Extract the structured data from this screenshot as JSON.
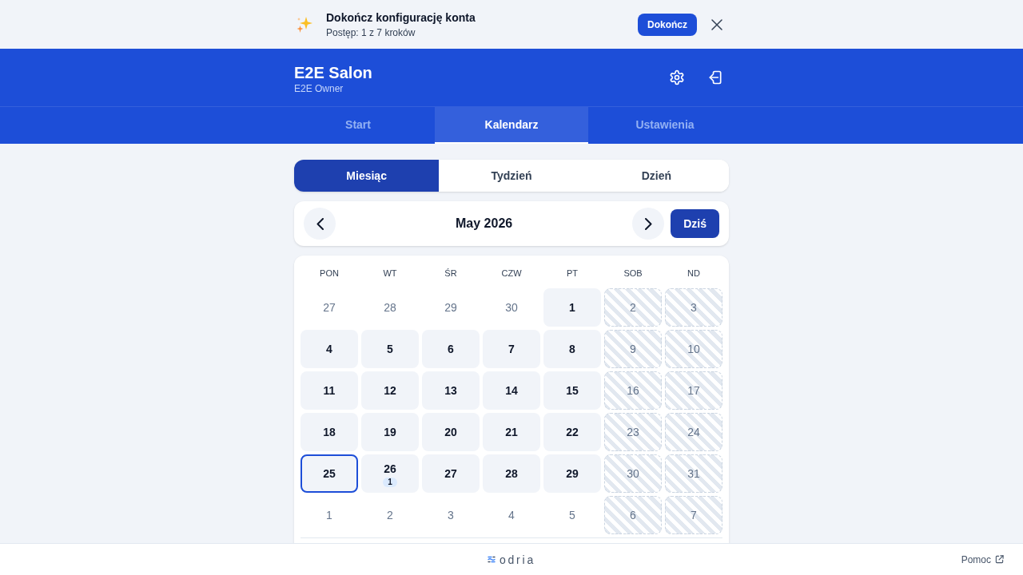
{
  "banner": {
    "title": "Dokończ konfigurację konta",
    "subtitle": "Postęp: 1 z 7 kroków",
    "button": "Dokończ"
  },
  "header": {
    "title": "E2E Salon",
    "subtitle": "E2E Owner"
  },
  "tabs": [
    {
      "label": "Start",
      "selected": false
    },
    {
      "label": "Kalendarz",
      "selected": true
    },
    {
      "label": "Ustawienia",
      "selected": false
    }
  ],
  "view_switch": [
    {
      "label": "Miesiąc",
      "selected": true
    },
    {
      "label": "Tydzień",
      "selected": false
    },
    {
      "label": "Dzień",
      "selected": false
    }
  ],
  "calendar": {
    "month_label": "May 2026",
    "today_button": "Dziś",
    "weekdays": [
      "PON",
      "WT",
      "ŚR",
      "CZW",
      "PT",
      "SOB",
      "ND"
    ],
    "weeks": [
      [
        {
          "day": "27",
          "kind": "outside",
          "today": false
        },
        {
          "day": "28",
          "kind": "outside",
          "today": false
        },
        {
          "day": "29",
          "kind": "outside",
          "today": false
        },
        {
          "day": "30",
          "kind": "outside",
          "today": false
        },
        {
          "day": "1",
          "kind": "open",
          "today": false
        },
        {
          "day": "2",
          "kind": "closed",
          "today": false
        },
        {
          "day": "3",
          "kind": "closed",
          "today": false
        }
      ],
      [
        {
          "day": "4",
          "kind": "open",
          "today": false
        },
        {
          "day": "5",
          "kind": "open",
          "today": false
        },
        {
          "day": "6",
          "kind": "open",
          "today": false
        },
        {
          "day": "7",
          "kind": "open",
          "today": false
        },
        {
          "day": "8",
          "kind": "open",
          "today": false
        },
        {
          "day": "9",
          "kind": "closed",
          "today": false
        },
        {
          "day": "10",
          "kind": "closed",
          "today": false
        }
      ],
      [
        {
          "day": "11",
          "kind": "open",
          "today": false
        },
        {
          "day": "12",
          "kind": "open",
          "today": false
        },
        {
          "day": "13",
          "kind": "open",
          "today": false
        },
        {
          "day": "14",
          "kind": "open",
          "today": false
        },
        {
          "day": "15",
          "kind": "open",
          "today": false
        },
        {
          "day": "16",
          "kind": "closed",
          "today": false
        },
        {
          "day": "17",
          "kind": "closed",
          "today": false
        }
      ],
      [
        {
          "day": "18",
          "kind": "open",
          "today": false
        },
        {
          "day": "19",
          "kind": "open",
          "today": false
        },
        {
          "day": "20",
          "kind": "open",
          "today": false
        },
        {
          "day": "21",
          "kind": "open",
          "today": false
        },
        {
          "day": "22",
          "kind": "open",
          "today": false
        },
        {
          "day": "23",
          "kind": "closed",
          "today": false
        },
        {
          "day": "24",
          "kind": "closed",
          "today": false
        }
      ],
      [
        {
          "day": "25",
          "kind": "open",
          "today": true
        },
        {
          "day": "26",
          "kind": "open",
          "today": false,
          "badge": "1"
        },
        {
          "day": "27",
          "kind": "open",
          "today": false
        },
        {
          "day": "28",
          "kind": "open",
          "today": false
        },
        {
          "day": "29",
          "kind": "open",
          "today": false
        },
        {
          "day": "30",
          "kind": "closed",
          "today": false
        },
        {
          "day": "31",
          "kind": "closed",
          "today": false
        }
      ],
      [
        {
          "day": "1",
          "kind": "outside",
          "today": false
        },
        {
          "day": "2",
          "kind": "outside",
          "today": false
        },
        {
          "day": "3",
          "kind": "outside",
          "today": false
        },
        {
          "day": "4",
          "kind": "outside",
          "today": false
        },
        {
          "day": "5",
          "kind": "outside",
          "today": false
        },
        {
          "day": "6",
          "kind": "closed",
          "today": false
        },
        {
          "day": "7",
          "kind": "closed",
          "today": false
        }
      ]
    ]
  },
  "footer": {
    "logo": "odria",
    "help_link": "Pomoc"
  }
}
